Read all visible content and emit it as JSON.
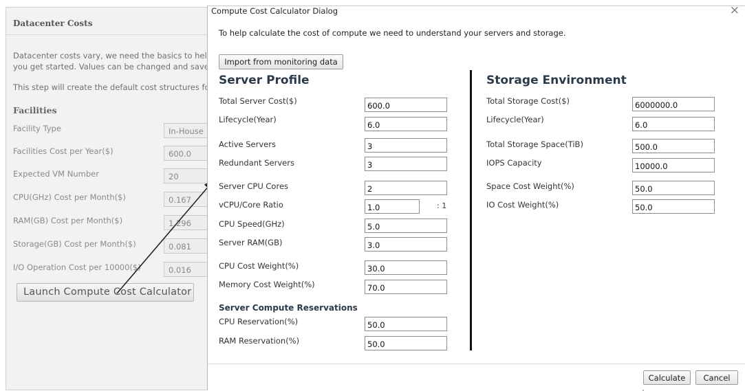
{
  "background": {
    "header": "Datacenter Costs",
    "intro": "Datacenter costs vary, we need the basics to help you get started. Values can be changed and saved.",
    "step_text": "This step will create the default cost structures for your datacenter.",
    "section": "Facilities",
    "rows": [
      {
        "label": "Facility Type",
        "value": "In-House"
      },
      {
        "label": "Facilities Cost per Year($)",
        "value": "600.0"
      },
      {
        "label": "Expected VM Number",
        "value": "20"
      },
      {
        "label": "CPU(GHz) Cost per Month($)",
        "value": "0.167"
      },
      {
        "label": "RAM(GB) Cost per Month($)",
        "value": "1.296"
      },
      {
        "label": "Storage(GB) Cost per Month($)",
        "value": "0.081"
      },
      {
        "label": "I/O Operation Cost per 10000($)",
        "value": "0.016"
      }
    ],
    "launch_button": "Launch Compute Cost Calculator"
  },
  "dialog": {
    "title": "Compute Cost Calculator Dialog",
    "close_glyph": "×",
    "intro": "To help calculate the cost of compute we need to understand your servers and storage.",
    "import_button": "Import from monitoring data",
    "server_profile": {
      "title": "Server Profile",
      "rows": [
        {
          "label": "Total Server Cost($)",
          "value": "600.0"
        },
        {
          "label": "Lifecycle(Year)",
          "value": "6.0"
        },
        {
          "label": "Active Servers",
          "value": "3"
        },
        {
          "label": "Redundant Servers",
          "value": "3"
        },
        {
          "label": "Server CPU Cores",
          "value": "2"
        },
        {
          "label": "vCPU/Core Ratio",
          "value": "1.0"
        },
        {
          "label": "CPU Speed(GHz)",
          "value": "5.0"
        },
        {
          "label": "Server RAM(GB)",
          "value": "3.0"
        },
        {
          "label": "CPU Cost Weight(%)",
          "value": "30.0"
        },
        {
          "label": "Memory Cost Weight(%)",
          "value": "70.0"
        }
      ],
      "ratio_suffix": ": 1"
    },
    "reservations": {
      "title": "Server Compute Reservations",
      "rows": [
        {
          "label": "CPU Reservation(%)",
          "value": "50.0"
        },
        {
          "label": "RAM Reservation(%)",
          "value": "50.0"
        }
      ]
    },
    "storage": {
      "title": "Storage Environment",
      "rows": [
        {
          "label": "Total Storage Cost($)",
          "value": "6000000.0"
        },
        {
          "label": "Lifecycle(Year)",
          "value": "6.0"
        },
        {
          "label": "Total Storage Space(TiB)",
          "value": "500.0"
        },
        {
          "label": "IOPS Capacity",
          "value": "10000.0"
        },
        {
          "label": "Space Cost Weight(%)",
          "value": "50.0"
        },
        {
          "label": "IO Cost Weight(%)",
          "value": "50.0"
        }
      ]
    },
    "calculate_button": "Calculate",
    "cancel_button": "Cancel"
  }
}
